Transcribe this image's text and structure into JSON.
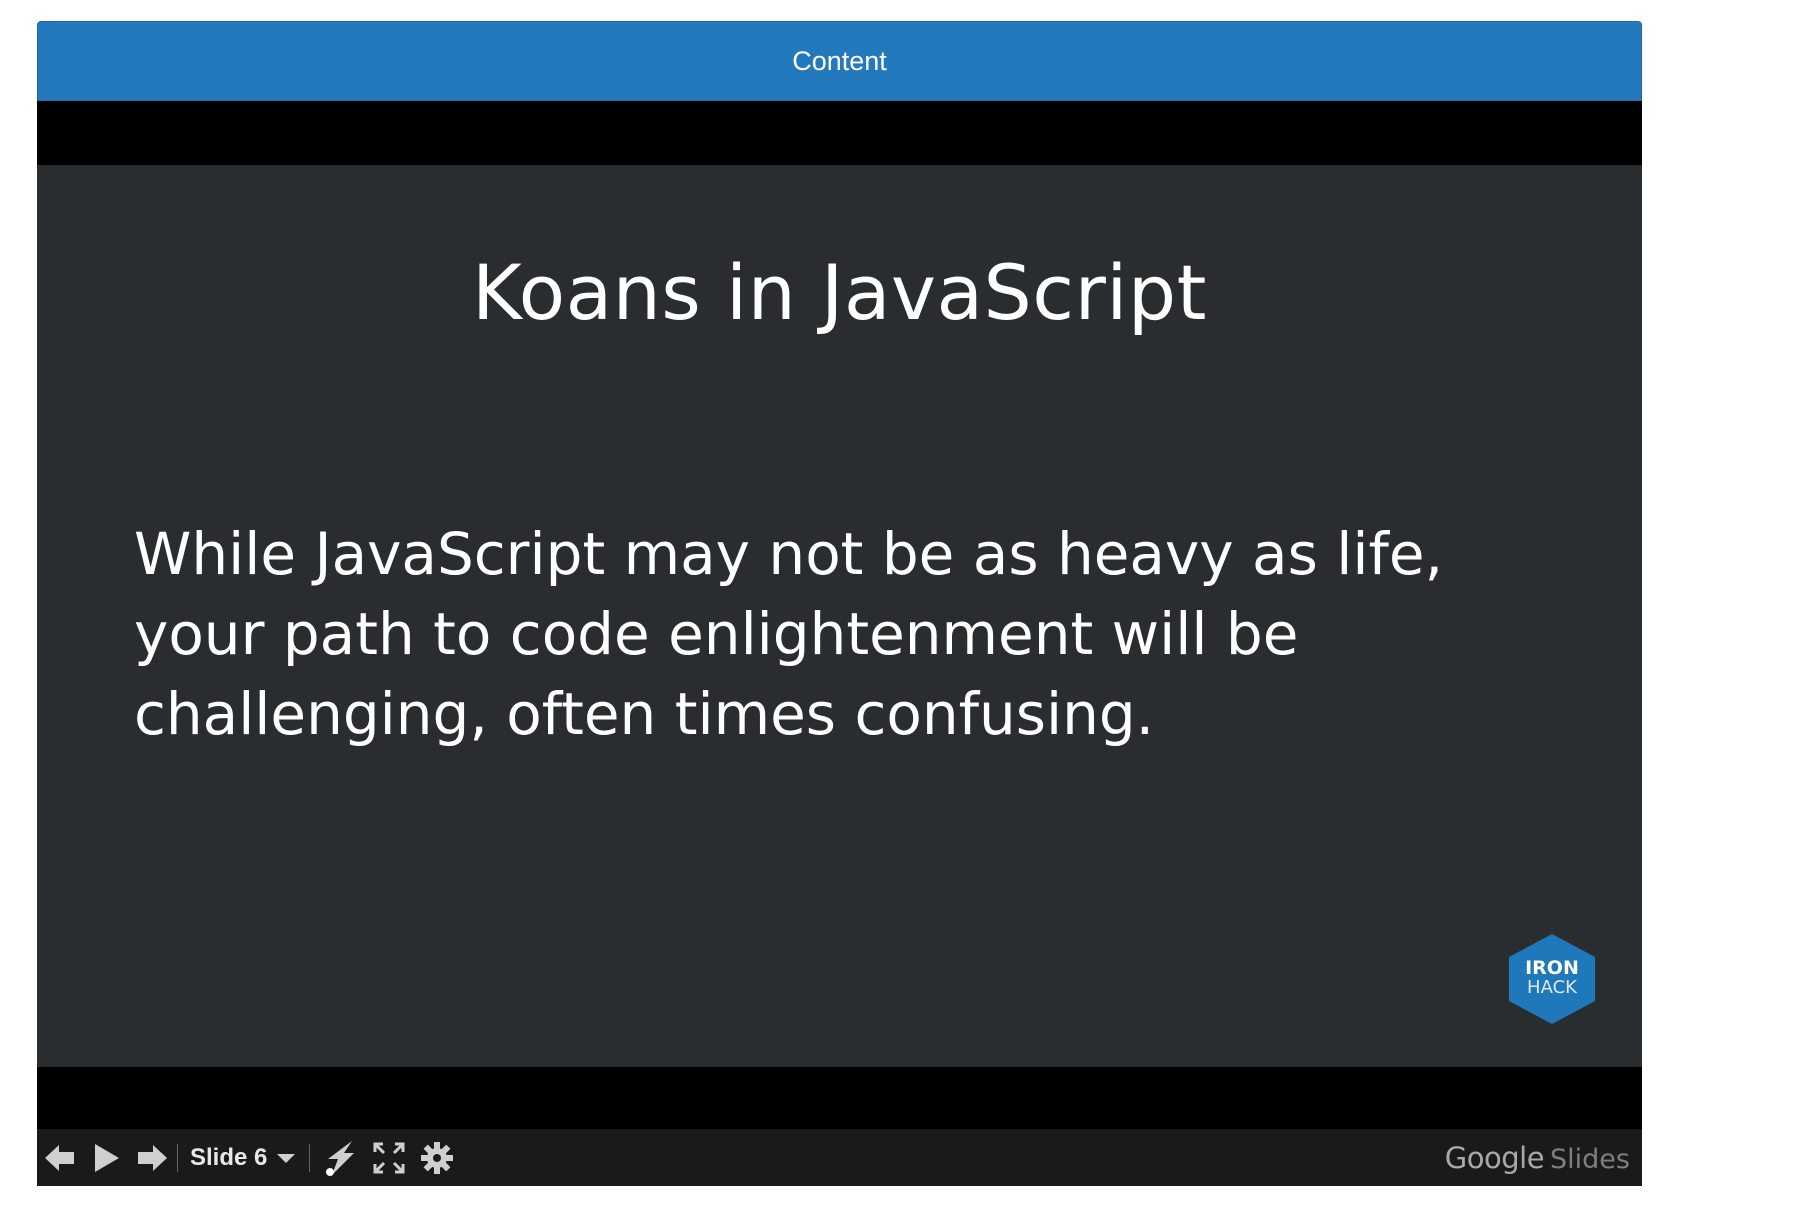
{
  "header": {
    "title": "Content"
  },
  "slide": {
    "title": "Koans in JavaScript",
    "body": "While JavaScript may not be as heavy as life, your path to code enlightenment will be challenging, often times confusing.",
    "logo": {
      "line1": "IRON",
      "line2": "HACK",
      "color": "#1f78b9"
    }
  },
  "toolbar": {
    "previous_icon": "arrow-left-icon",
    "play_icon": "play-icon",
    "next_icon": "arrow-right-icon",
    "slide_label": "Slide 6",
    "slide_dropdown_icon": "chevron-down-icon",
    "pointer_icon": "laser-pointer-icon",
    "fullscreen_icon": "fullscreen-icon",
    "settings_icon": "gear-icon"
  },
  "branding": {
    "google": "Google",
    "slides": "Slides"
  },
  "colors": {
    "header_bg": "#2479bd",
    "slide_bg": "#292d30",
    "viewer_bg": "#000000",
    "toolbar_bg": "#1a1a1a"
  }
}
